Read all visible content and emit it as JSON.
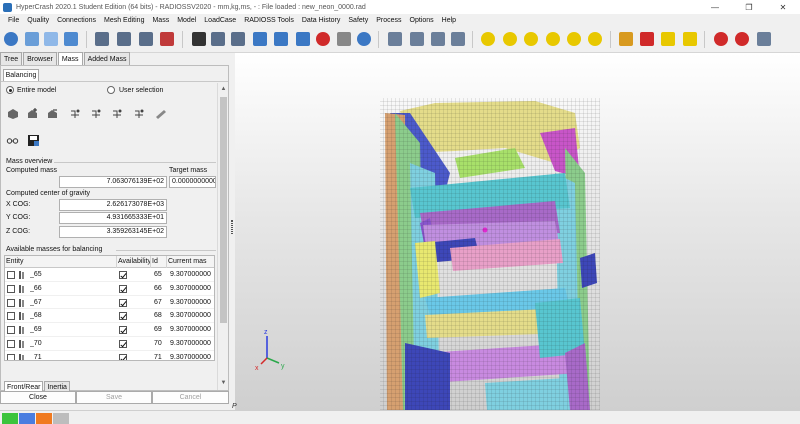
{
  "window": {
    "title": "HyperCrash 2020.1 Student Edition (64 bits) - RADIOSSV2020 - mm,kg,ms, - : File loaded : new_neon_0000.rad"
  },
  "menu": [
    "File",
    "Quality",
    "Connections",
    "Mesh Editing",
    "Mass",
    "Model",
    "LoadCase",
    "RADIOSS Tools",
    "Data History",
    "Safety",
    "Process",
    "Options",
    "Help"
  ],
  "tabs": [
    "Tree",
    "Browser",
    "Mass",
    "Added Mass"
  ],
  "subtab": "Balancing",
  "selection": {
    "entire_model": "Entire model",
    "user_selection": "User selection"
  },
  "mass_overview": {
    "section": "Mass overview",
    "computed_label": "Computed mass",
    "target_label": "Target mass",
    "computed_value": "7.063076139E+02",
    "target_value": "0.0000000000"
  },
  "cog": {
    "section": "Computed center of gravity",
    "x_label": "X COG:",
    "x_value": "2.626173078E+03",
    "y_label": "Y COG:",
    "y_value": "4.931665333E+01",
    "z_label": "Z COG:",
    "z_value": "3.359263145E+02"
  },
  "balancing_table": {
    "section": "Available masses for balancing",
    "columns": [
      "Entity",
      "Availability",
      "Id",
      "Current mas"
    ],
    "rows": [
      {
        "entity": "_65",
        "id": "65",
        "mass": "9.307000000"
      },
      {
        "entity": "_66",
        "id": "66",
        "mass": "9.307000000"
      },
      {
        "entity": "_67",
        "id": "67",
        "mass": "9.307000000"
      },
      {
        "entity": "_68",
        "id": "68",
        "mass": "9.307000000"
      },
      {
        "entity": "_69",
        "id": "69",
        "mass": "9.307000000"
      },
      {
        "entity": "_70",
        "id": "70",
        "mass": "9.307000000"
      },
      {
        "entity": "_71",
        "id": "71",
        "mass": "9.307000000"
      }
    ]
  },
  "bottom_tabs": [
    "Front/Rear",
    "Inertia"
  ],
  "buttons": {
    "close": "Close",
    "save": "Save",
    "cancel": "Cancel"
  },
  "axes": {
    "x": "x",
    "y": "y",
    "z": "z"
  },
  "viewport": {
    "corner_label": "P"
  },
  "colors": {
    "accent": "#2a6fb8",
    "statusbar_swatches": [
      "#3cc43c",
      "#4a7de0",
      "#f07a20",
      "#bdbdbd"
    ]
  }
}
